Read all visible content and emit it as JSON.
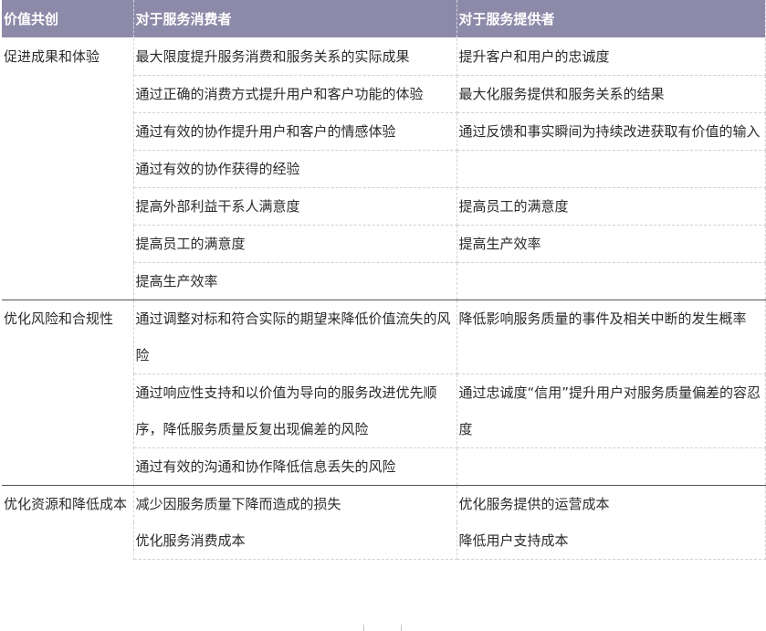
{
  "table": {
    "headers": [
      "价值共创",
      "对于服务消费者",
      "对于服务提供者"
    ],
    "groups": [
      {
        "label": "促进成果和体验",
        "rows": [
          {
            "consumer": "最大限度提升服务消费和服务关系的实际成果",
            "provider": "提升客户和用户的忠诚度"
          },
          {
            "consumer": "通过正确的消费方式提升用户和客户功能的体验",
            "provider": "最大化服务提供和服务关系的结果"
          },
          {
            "consumer": "通过有效的协作提升用户和客户的情感体验",
            "provider": "通过反馈和事实瞬间为持续改进获取有价值的输入"
          },
          {
            "consumer": "通过有效的协作获得的经验",
            "provider": ""
          },
          {
            "consumer": "提高外部利益干系人满意度",
            "provider": "提高员工的满意度"
          },
          {
            "consumer": "提高员工的满意度",
            "provider": "提高生产效率"
          },
          {
            "consumer": "提高生产效率",
            "provider": ""
          }
        ]
      },
      {
        "label": "优化风险和合规性",
        "rows": [
          {
            "consumer": "通过调整对标和符合实际的期望来降低价值流失的风险",
            "provider": "降低影响服务质量的事件及相关中断的发生概率"
          },
          {
            "consumer": "通过响应性支持和以价值为导向的服务改进优先顺序，降低服务质量反复出现偏差的风险",
            "provider": "通过忠诚度“信用”提升用户对服务质量偏差的容忍度"
          },
          {
            "consumer": "通过有效的沟通和协作降低信息丢失的风险",
            "provider": ""
          }
        ]
      },
      {
        "label": "优化资源和降低成本",
        "rows": [
          {
            "consumer": "减少因服务质量下降而造成的损失",
            "provider": "优化服务提供的运营成本"
          },
          {
            "consumer": "优化服务消费成本",
            "provider": "降低用户支持成本"
          }
        ]
      }
    ]
  }
}
